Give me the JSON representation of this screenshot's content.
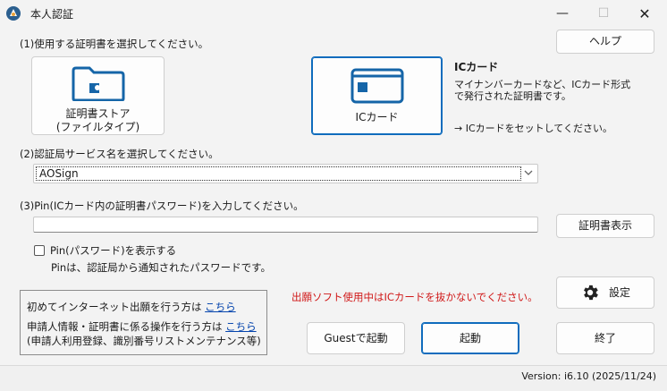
{
  "window": {
    "title": "本人認証",
    "minimize_glyph": "—",
    "maximize_glyph": "☐",
    "close_glyph": "✕"
  },
  "step1": {
    "label": "(1)使用する証明書を選択してください。",
    "cert_store_label_line1": "証明書ストア",
    "cert_store_label_line2": "(ファイルタイプ)",
    "ic_card_label": "ICカード",
    "desc_title": "ICカード",
    "desc_line1": "マイナンバーカードなど、ICカード形式",
    "desc_line2": "で発行された証明書です。",
    "desc_instruction": "→ ICカードをセットしてください。"
  },
  "help_button": "ヘルプ",
  "step2": {
    "label": "(2)認証局サービス名を選択してください。",
    "selected": "AOSign"
  },
  "step3": {
    "label": "(3)Pin(ICカード内の証明書パスワード)を入力してください。",
    "pin_value": "",
    "show_cert_button": "証明書表示",
    "show_pin_label": "Pin(パスワード)を表示する",
    "show_pin_checked": false,
    "pin_note": "Pinは、認証局から通知されたパスワードです。"
  },
  "info": {
    "first_time_text": "初めてインターネット出願を行う方は",
    "first_time_link": "こちら",
    "applicant_text": "申請人情報・証明書に係る操作を行う方は",
    "applicant_link": "こちら",
    "applicant_note": "(申請人利用登録、識別番号リストメンテナンス等)"
  },
  "warning": "出願ソフト使用中はICカードを抜かないでください。",
  "buttons": {
    "settings": "設定",
    "guest_start": "Guestで起動",
    "start": "起動",
    "exit": "終了"
  },
  "status": {
    "version": "Version: i6.10 (2025/11/24)"
  },
  "colors": {
    "accent": "#0f6cbd",
    "warning": "#d01818",
    "link": "#0645ad"
  }
}
